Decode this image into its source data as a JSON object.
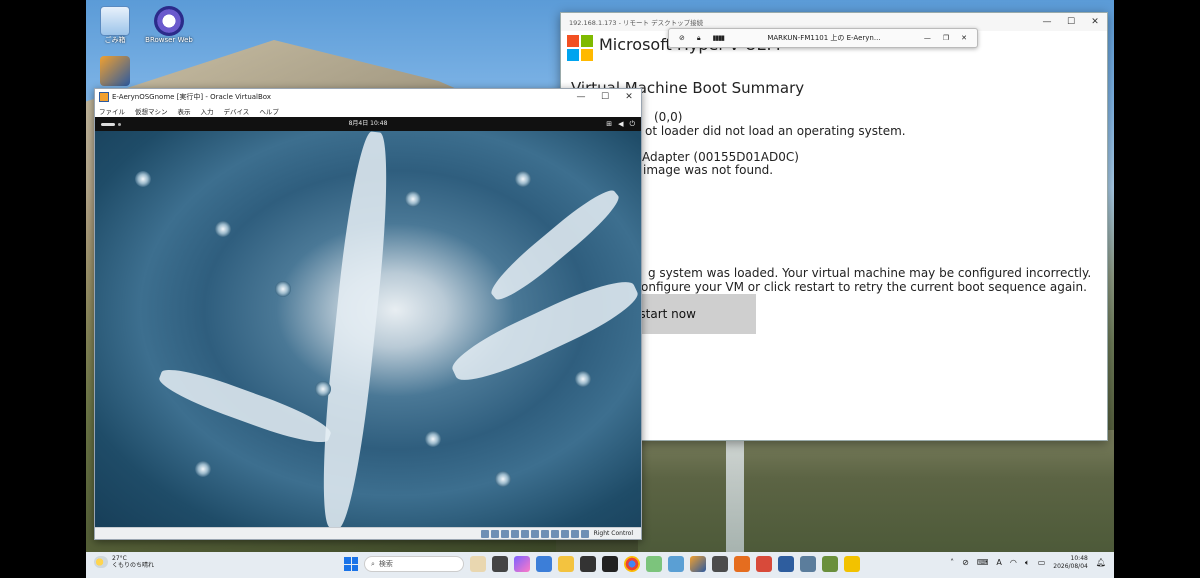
{
  "desktop": {
    "icons": [
      {
        "label": "ごみ箱"
      },
      {
        "label": "BRowser Web"
      }
    ]
  },
  "virtualbox": {
    "title": "E-AerynOSGnome [実行中] - Oracle VirtualBox",
    "menu": [
      "ファイル",
      "仮想マシン",
      "表示",
      "入力",
      "デバイス",
      "ヘルプ"
    ],
    "guest_clock": "8月4日  10:48",
    "host_key": "Right Control"
  },
  "hyperv": {
    "window_title": "192.168.1.173 - リモート デスクトップ接続",
    "heading": "Microsoft Hyper-V UEFI",
    "section": "Virtual Machine Boot Summary",
    "lines": [
      "(0,0)",
      "ot loader did not load an operating system.",
      "Adapter (00155D01AD0C)",
      "image was not found.",
      "g system was loaded. Your virtual machine may be configured incorrectly.",
      "onfigure your VM or click restart to retry the current boot sequence again."
    ],
    "restart_label": "estart now"
  },
  "rdp_bar": {
    "host": "MARKUN-FM1101 上の E-Aeryn..."
  },
  "taskbar": {
    "weather_temp": "27°C",
    "weather_desc": "くもりのち晴れ",
    "search_placeholder": "検索",
    "time": "10:48",
    "date": "2026/08/04",
    "ime": "A"
  }
}
